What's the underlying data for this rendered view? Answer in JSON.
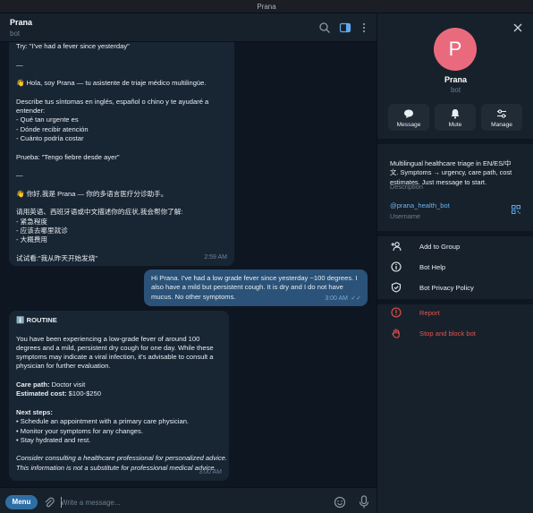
{
  "window": {
    "title": "Prana"
  },
  "chat": {
    "header": {
      "name": "Prana",
      "subtitle": "bot"
    },
    "messages": [
      {
        "direction": "in",
        "lines": [
          "Try: \"I've had a fever since yesterday\"",
          "",
          "—",
          "",
          "👋 Hola, soy Prana — tu asistente de triaje médico multilingüe.",
          "",
          "Describe tus síntomas en inglés, español o chino y te ayudaré a",
          "entender:",
          "- Qué tan urgente es",
          "- Dónde recibir atención",
          "- Cuánto podría costar",
          "",
          "Prueba: \"Tengo fiebre desde ayer\"",
          "",
          "—",
          "",
          "👋 你好,我是 Prana — 你的多语言医疗分诊助手。",
          "",
          "请用英语、西班牙语或中文描述你的症状,我会帮你了解:",
          "- 紧急程度",
          "- 应该去哪里就诊",
          "- 大概费用",
          "",
          "试试看:\"我从昨天开始发烧\""
        ],
        "time": "2:59 AM"
      },
      {
        "direction": "out",
        "lines": [
          "Hi Prana. I've had a low grade fever since yesterday ~100 degrees. I",
          "also have a mild but persistent cough. It is dry and I do not have",
          "mucus. No other symptoms."
        ],
        "time": "3:00 AM"
      },
      {
        "direction": "in",
        "badge": "ℹ️",
        "heading": "ROUTINE",
        "paragraph": [
          "You have been experiencing a low-grade fever of around 100",
          "degrees and a mild, persistent dry cough for one day. While these",
          "symptoms may indicate a viral infection, it's advisable to consult a",
          "physician for further evaluation."
        ],
        "care_path_label": "Care path:",
        "care_path_value": " Doctor visit",
        "cost_label": "Estimated cost:",
        "cost_value": " $100-$250",
        "next_label": "Next steps:",
        "steps": [
          "• Schedule an appointment with a primary care physician.",
          "• Monitor your symptoms for any changes.",
          "• Stay hydrated and rest."
        ],
        "disclaimer": [
          "Consider consulting a healthcare professional for personalized advice.",
          "This information is not a substitute for professional medical advice."
        ],
        "time": "3:00 AM"
      }
    ],
    "composer": {
      "menu_label": "Menu",
      "placeholder": "Write a message..."
    }
  },
  "panel": {
    "avatar_letter": "P",
    "name": "Prana",
    "subtitle": "bot",
    "actions": [
      {
        "label": "Message",
        "icon": "message-icon"
      },
      {
        "label": "Mute",
        "icon": "bell-icon"
      },
      {
        "label": "Manage",
        "icon": "sliders-icon"
      }
    ],
    "description_lines": [
      "Multilingual healthcare triage in EN/ES/中",
      "文. Symptoms → urgency, care path, cost",
      "estimates. Just message to start."
    ],
    "description_caption": "Description",
    "username": "@prana_health_bot",
    "username_caption": "Username",
    "menu": [
      {
        "label": "Add to Group",
        "icon": "add-user-icon"
      },
      {
        "label": "Bot Help",
        "icon": "info-icon"
      },
      {
        "label": "Bot Privacy Policy",
        "icon": "shield-icon"
      }
    ],
    "danger_menu": [
      {
        "label": "Report",
        "icon": "report-icon"
      },
      {
        "label": "Stop and block bot",
        "icon": "hand-icon"
      }
    ]
  },
  "colors": {
    "accent": "#2f6ea5",
    "danger": "#e5534b",
    "avatar": "#ea6a7d",
    "outgoing": "#2b5278",
    "incoming": "#182533"
  }
}
